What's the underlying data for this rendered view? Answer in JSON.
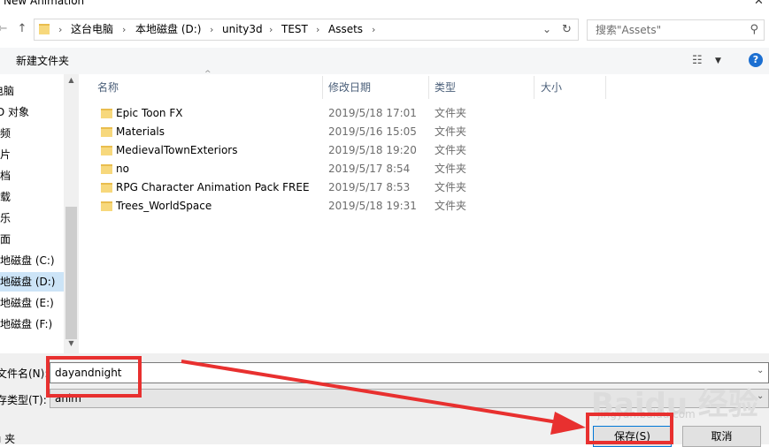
{
  "window": {
    "title": "New Animation",
    "close_glyph": "✕"
  },
  "nav_buttons": {
    "back": "←",
    "forward": "→",
    "recent": "⌄",
    "up": "↑"
  },
  "address": {
    "crumbs": [
      "这台电脑",
      "本地磁盘 (D:)",
      "unity3d",
      "TEST",
      "Assets"
    ],
    "separator": "›",
    "refresh_glyph": "↻",
    "dropdown_glyph": "⌄"
  },
  "search": {
    "placeholder": "搜索\"Assets\"",
    "icon": "search-icon",
    "glyph": "⚲"
  },
  "toolbar": {
    "new_folder": "新建文件夹",
    "view_glyph": "☷",
    "view_drop": "▼",
    "help_glyph": "?"
  },
  "sidebar": {
    "items": [
      {
        "label": "电脑",
        "selected": false
      },
      {
        "label": "D 对象",
        "selected": false
      },
      {
        "label": "频",
        "selected": false
      },
      {
        "label": "片",
        "selected": false
      },
      {
        "label": "档",
        "selected": false
      },
      {
        "label": "载",
        "selected": false
      },
      {
        "label": "乐",
        "selected": false
      },
      {
        "label": "面",
        "selected": false
      },
      {
        "label": "地磁盘 (C:)",
        "selected": false
      },
      {
        "label": "地磁盘 (D:)",
        "selected": true
      },
      {
        "label": "地磁盘 (E:)",
        "selected": false
      },
      {
        "label": "地磁盘 (F:)",
        "selected": false
      }
    ],
    "scroll_up": "▲",
    "scroll_down": "▼"
  },
  "file_list": {
    "columns": {
      "name": "名称",
      "date": "修改日期",
      "type": "类型",
      "size": "大小"
    },
    "sort_caret": "^",
    "rows": [
      {
        "name": "Epic Toon FX",
        "date": "2019/5/18 17:01",
        "type": "文件夹"
      },
      {
        "name": "Materials",
        "date": "2019/5/16 15:05",
        "type": "文件夹"
      },
      {
        "name": "MedievalTownExteriors",
        "date": "2019/5/18 19:20",
        "type": "文件夹"
      },
      {
        "name": "no",
        "date": "2019/5/17 8:54",
        "type": "文件夹"
      },
      {
        "name": "RPG Character Animation Pack FREE",
        "date": "2019/5/17 8:53",
        "type": "文件夹"
      },
      {
        "name": "Trees_WorldSpace",
        "date": "2019/5/18 19:31",
        "type": "文件夹"
      }
    ]
  },
  "form": {
    "filename_label": "文件名(N):",
    "filename_value": "dayandnight",
    "filetype_label": "存类型(T):",
    "filetype_value": "anim",
    "dropdown_glyph": "⌄",
    "hide_folders": "ı 夹"
  },
  "buttons": {
    "save": "保存(S)",
    "cancel": "取消"
  },
  "watermark": {
    "brand": "Baidu 经验",
    "url": "jingyan.baidu.com"
  },
  "colors": {
    "annotation": "#e8302f",
    "selection": "#cce4f7",
    "accent": "#0078d7"
  }
}
